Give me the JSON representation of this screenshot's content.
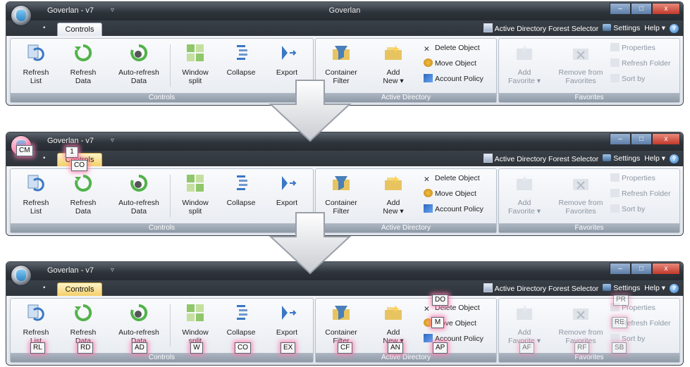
{
  "app_title": "Goverlan - v7",
  "window_title": "Goverlan",
  "controls": {
    "close": "x",
    "minimize": "–",
    "maximize": "□",
    "qat_dropdown": "▿",
    "pin": "▪"
  },
  "tab_label": "Controls",
  "right_bar": {
    "forest_selector": "Active Directory Forest Selector",
    "settings": "Settings",
    "help": "Help ▾",
    "help_badge": "?"
  },
  "groups": {
    "controls_label": "Controls",
    "ad_label": "Active Directory",
    "fav_label": "Favorites"
  },
  "controls_buttons": [
    {
      "l1": "Refresh",
      "l2": "List",
      "tip": "RL"
    },
    {
      "l1": "Refresh",
      "l2": "Data",
      "tip": "RD"
    },
    {
      "l1": "Auto-refresh",
      "l2": "Data",
      "tip": "AD"
    },
    {
      "l1": "Window",
      "l2": "split",
      "tip": "W"
    },
    {
      "l1": "Collapse",
      "l2": "",
      "tip": "CO"
    },
    {
      "l1": "Export",
      "l2": "",
      "tip": "EX"
    }
  ],
  "ad_buttons": [
    {
      "l1": "Container",
      "l2": "Filter",
      "tip": "CF"
    },
    {
      "l1": "Add",
      "l2": "New ▾",
      "tip": "AN"
    }
  ],
  "ad_small": [
    {
      "label": "Delete Object",
      "tip": "DO"
    },
    {
      "label": "Move Object",
      "tip": "M"
    },
    {
      "label": "Account Policy",
      "tip": "AP"
    }
  ],
  "fav_buttons": [
    {
      "l1": "Add",
      "l2": "Favorite ▾",
      "tip": "AF"
    },
    {
      "l1": "Remove from",
      "l2": "Favorites",
      "tip": "RF"
    }
  ],
  "fav_small": [
    {
      "label": "Properties",
      "tip": "PR"
    },
    {
      "label": "Refresh Folder",
      "tip": "RE"
    },
    {
      "label": "Sort by",
      "tip": "SB"
    }
  ],
  "keytips_step2": {
    "orb": "CM",
    "tab_number": "1",
    "tab": "CO"
  },
  "colors": {
    "keytip_glow": "#ff78aa",
    "tab_highlight": "#f4cf68"
  }
}
